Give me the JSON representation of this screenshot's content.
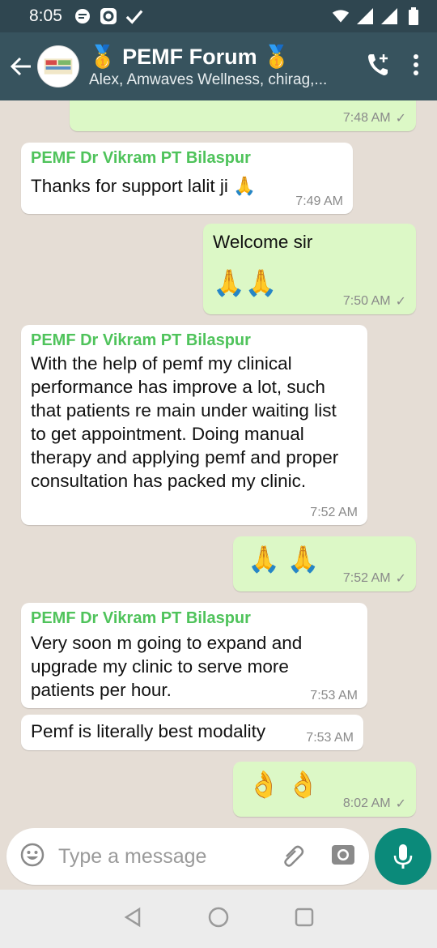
{
  "status_bar": {
    "time": "8:05"
  },
  "header": {
    "title": "🥇 PEMF Forum 🥇",
    "subtitle": "Alex, Amwaves Wellness, chirag,..."
  },
  "messages": [
    {
      "type": "out",
      "text": "",
      "time": "7:48 AM"
    },
    {
      "type": "in",
      "sender": "PEMF Dr Vikram PT Bilaspur",
      "text": "Thanks for support lalit ji 🙏",
      "time": "7:49 AM"
    },
    {
      "type": "out",
      "text": "Welcome sir",
      "emoji": "🙏🙏",
      "time": "7:50 AM"
    },
    {
      "type": "in",
      "sender": "PEMF Dr Vikram PT Bilaspur",
      "text": "With the help of pemf my clinical performance has improve a lot, such that patients re main under waiting list to get appointment. Doing manual therapy and applying pemf and proper consultation has packed my clinic.",
      "time": "7:52 AM"
    },
    {
      "type": "out",
      "emoji": "🙏 🙏",
      "time": "7:52 AM"
    },
    {
      "type": "in",
      "sender": "PEMF Dr Vikram PT Bilaspur",
      "text": "Very soon m going to expand and upgrade my clinic to serve more patients per hour.",
      "time": "7:53 AM"
    },
    {
      "type": "in",
      "text": "Pemf is literally best modality",
      "time": "7:53 AM"
    },
    {
      "type": "out",
      "emoji": "👌 👌",
      "time": "8:02 AM"
    }
  ],
  "input": {
    "placeholder": "Type a message"
  },
  "icons": {
    "back": "arrow-left-icon",
    "call": "add-call-icon",
    "menu": "more-vert-icon",
    "emoji": "emoji-icon",
    "attach": "paperclip-icon",
    "camera": "camera-icon",
    "mic": "mic-icon"
  },
  "colors": {
    "header": "#37535e",
    "status_bar": "#2f4650",
    "out_bubble": "#dcf8c6",
    "in_bubble": "#ffffff",
    "sender": "#4fc35b",
    "mic_button": "#0b8a7a"
  }
}
